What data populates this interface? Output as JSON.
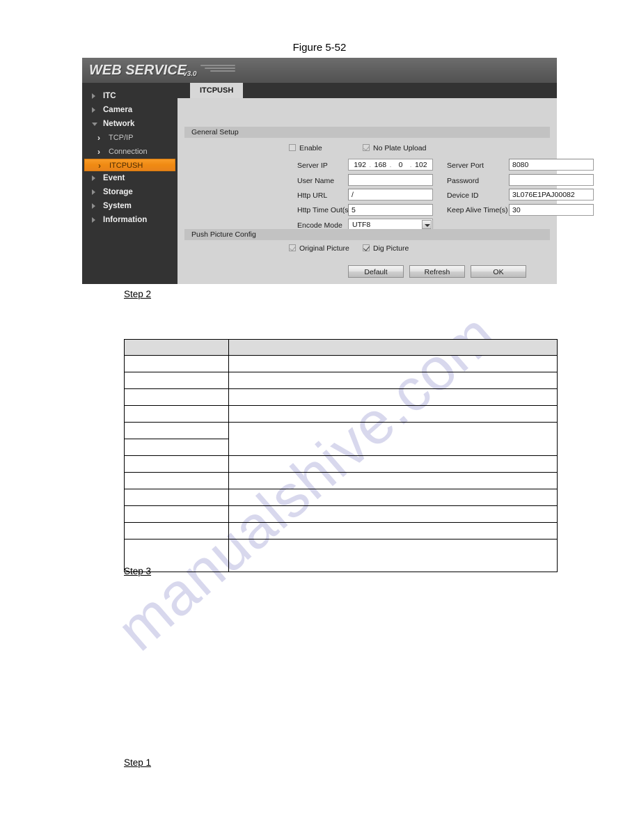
{
  "document": {
    "figure_caption": "Figure 5-52",
    "watermark": "manualshive.com",
    "steps": {
      "step2": "Step 2",
      "step3": "Step 3",
      "step1": "Step 1"
    }
  },
  "device_ui": {
    "logo": {
      "text": "WEB  SERVICE",
      "version": "v3.0"
    },
    "sidebar": {
      "items": [
        {
          "label": "ITC",
          "type": "group",
          "expanded": false
        },
        {
          "label": "Camera",
          "type": "group",
          "expanded": false
        },
        {
          "label": "Network",
          "type": "group",
          "expanded": true
        },
        {
          "label": "TCP/IP",
          "type": "sub",
          "active": false
        },
        {
          "label": "Connection",
          "type": "sub",
          "active": false
        },
        {
          "label": "ITCPUSH",
          "type": "sub",
          "active": true
        },
        {
          "label": "Event",
          "type": "group",
          "expanded": false
        },
        {
          "label": "Storage",
          "type": "group",
          "expanded": false
        },
        {
          "label": "System",
          "type": "group",
          "expanded": false
        },
        {
          "label": "Information",
          "type": "group",
          "expanded": false
        }
      ],
      "active_color": "#f0901a"
    },
    "tabs": [
      {
        "label": "ITCPUSH",
        "selected": true
      }
    ],
    "sections": {
      "general_setup": {
        "title": "General Setup",
        "checkboxes": [
          {
            "label": "Enable",
            "checked": false,
            "enabled": true
          },
          {
            "label": "No Plate Upload",
            "checked": true,
            "enabled": false
          }
        ],
        "fields_left": [
          {
            "label": "Server IP",
            "value": "192.168.0.102",
            "type": "ip"
          },
          {
            "label": "User Name",
            "value": "",
            "type": "text"
          },
          {
            "label": "Http URL",
            "value": "/",
            "type": "text"
          },
          {
            "label": "Http Time Out(s)",
            "value": "5",
            "type": "text"
          },
          {
            "label": "Encode Mode",
            "value": "UTF8",
            "type": "select"
          }
        ],
        "ip_octets": [
          "192",
          "168",
          "0",
          "102"
        ],
        "fields_right": [
          {
            "label": "Server Port",
            "value": "8080",
            "type": "text"
          },
          {
            "label": "Password",
            "value": "",
            "type": "text"
          },
          {
            "label": "Device ID",
            "value": "3L076E1PAJ00082",
            "type": "text"
          },
          {
            "label": "Keep Alive Time(s)",
            "value": "30",
            "type": "text"
          }
        ]
      },
      "push_picture_config": {
        "title": "Push Picture Config",
        "checkboxes": [
          {
            "label": "Original Picture",
            "checked": true,
            "enabled": false
          },
          {
            "label": "Dig Picture",
            "checked": true,
            "enabled": true
          }
        ]
      }
    },
    "buttons": [
      {
        "label": "Default"
      },
      {
        "label": "Refresh"
      },
      {
        "label": "OK"
      }
    ]
  },
  "data_table": {
    "columns": [
      "",
      ""
    ],
    "header": [
      "",
      ""
    ],
    "rows": [
      [
        "",
        ""
      ],
      [
        "",
        ""
      ],
      [
        "",
        ""
      ],
      [
        "",
        ""
      ],
      [
        "",
        ""
      ],
      [
        "",
        ""
      ],
      [
        "",
        ""
      ],
      [
        "",
        ""
      ],
      [
        "",
        ""
      ],
      [
        "",
        ""
      ],
      [
        "",
        ""
      ],
      [
        "",
        ""
      ]
    ]
  }
}
